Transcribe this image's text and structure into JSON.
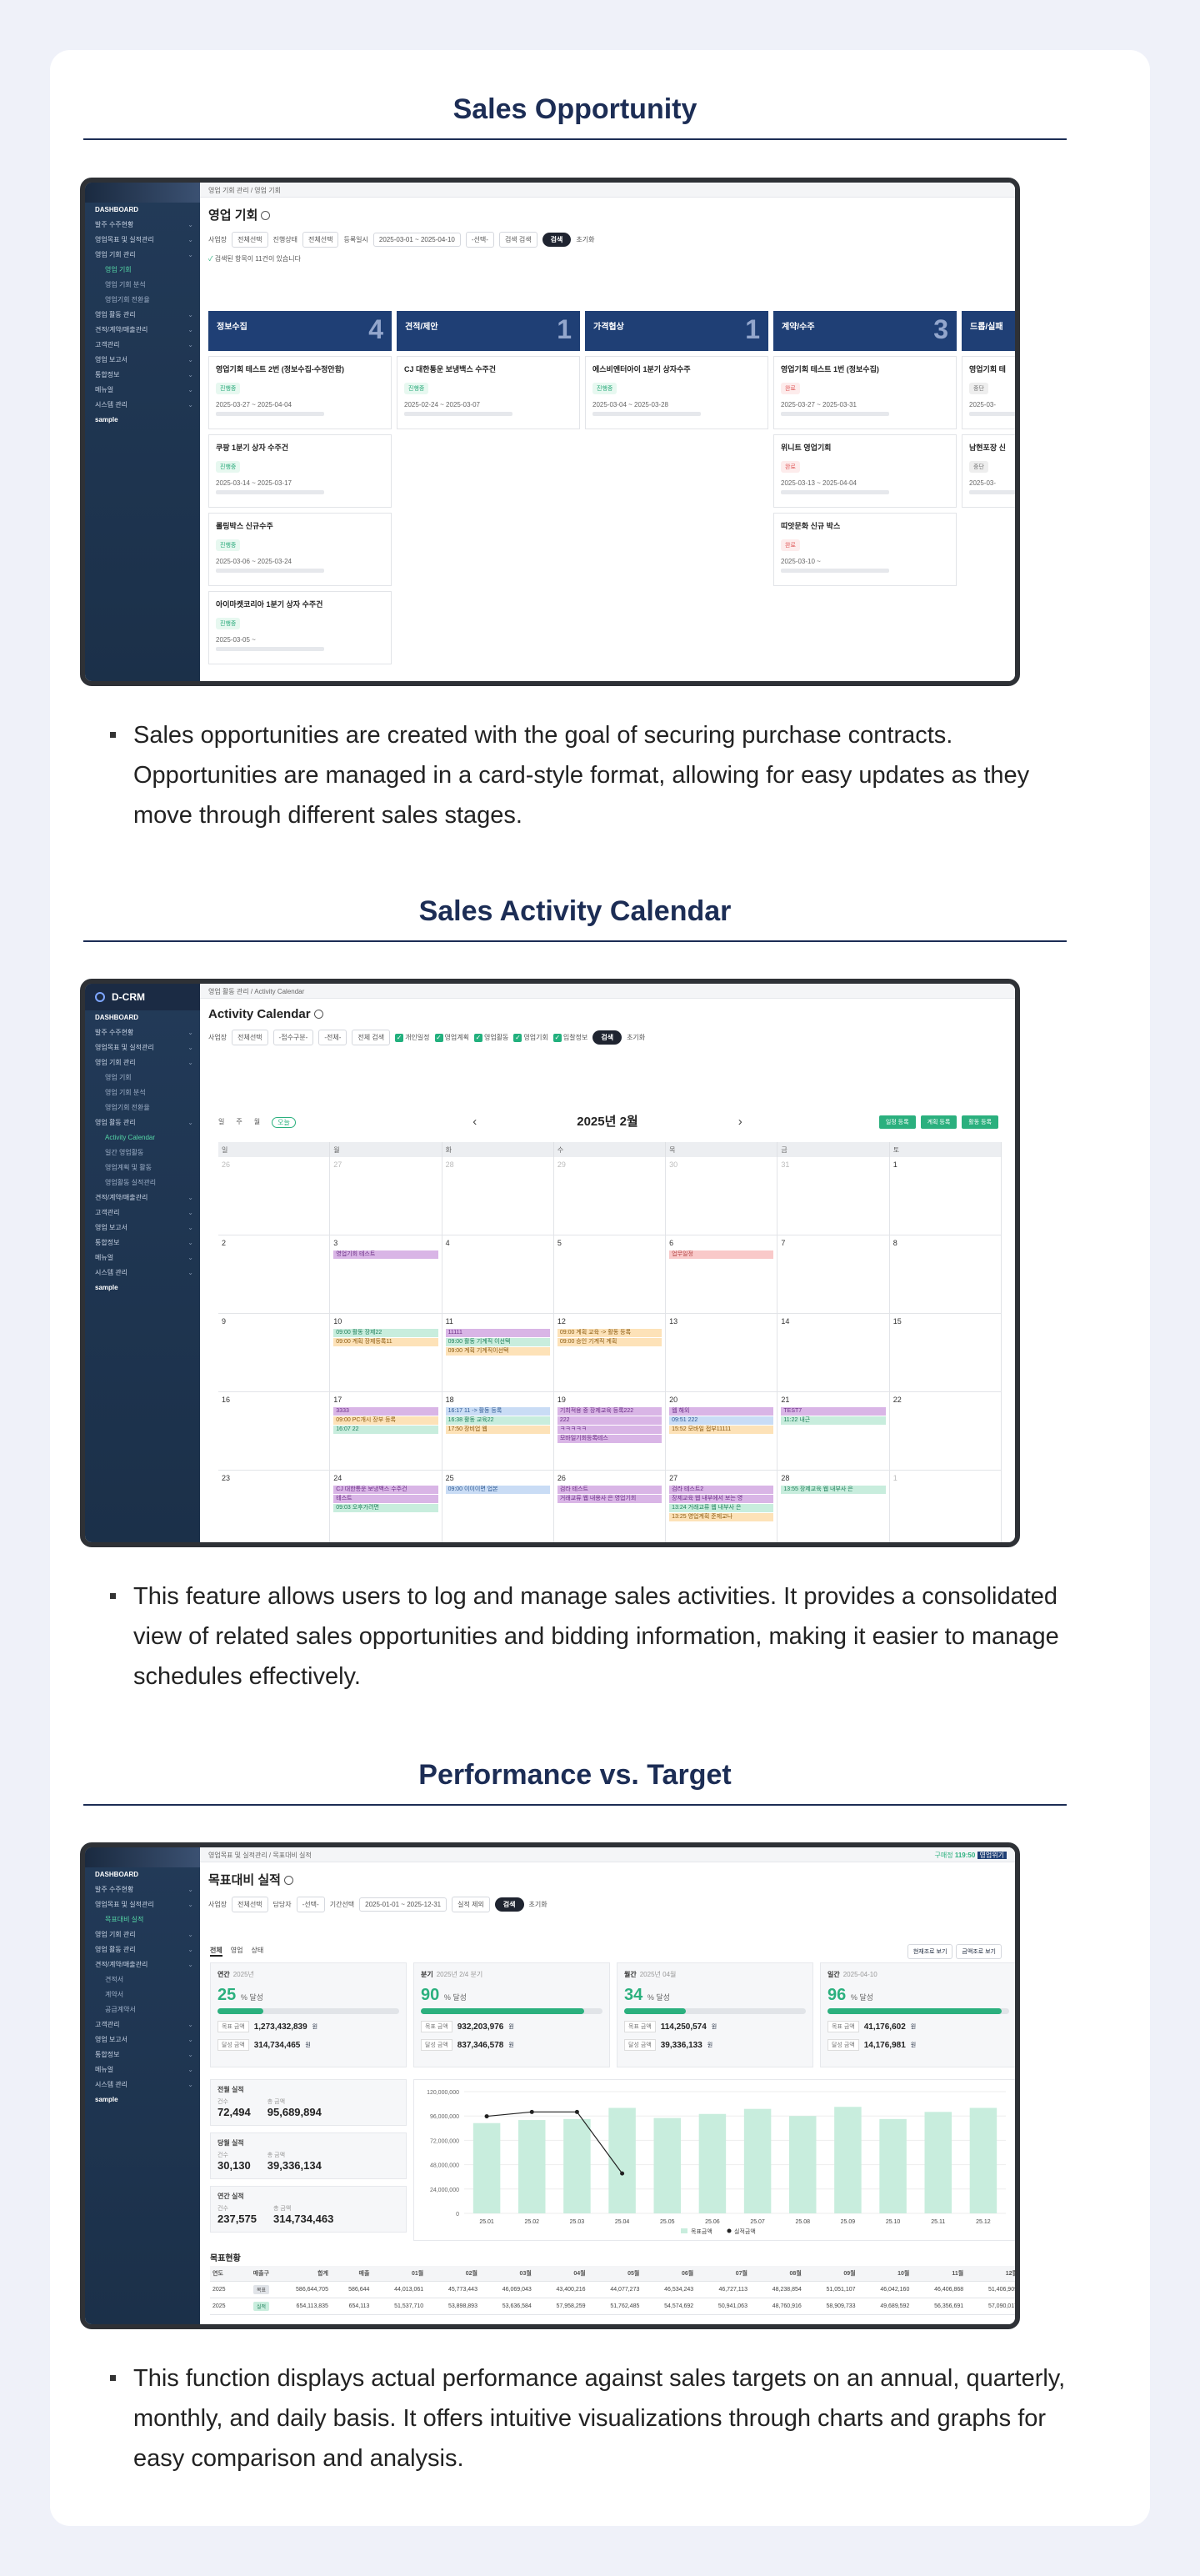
{
  "sections": [
    {
      "title": "Sales Opportunity",
      "description": "Sales opportunities are created with the goal of securing purchase contracts. Opportunities are managed in a card-style format, allowing for easy updates as they move through different sales stages."
    },
    {
      "title": "Sales Activity Calendar",
      "description": "This feature allows users to log and manage sales activities. It provides a consolidated view of related sales opportunities and bidding information, making it easier to manage schedules effectively."
    },
    {
      "title": "Performance vs. Target",
      "description": "This function displays actual performance against sales targets on an annual, quarterly, monthly, and daily basis. It offers intuitive visualizations through charts and graphs for easy comparison and analysis."
    }
  ],
  "app": {
    "brand": "D-CRM",
    "sidebar": [
      {
        "label": "DASHBOARD",
        "level": "head"
      },
      {
        "label": "발주 수주현황",
        "level": "top"
      },
      {
        "label": "영업목표 및 실적관리",
        "level": "top"
      },
      {
        "label": "영업 기회 관리",
        "level": "top"
      },
      {
        "label": "영업 기회",
        "level": "sub",
        "active": true
      },
      {
        "label": "영업 기회 분석",
        "level": "sub"
      },
      {
        "label": "영업기회 전환율",
        "level": "sub"
      },
      {
        "label": "영업 활동 관리",
        "level": "top"
      },
      {
        "label": "견적/계약/매출관리",
        "level": "top"
      },
      {
        "label": "고객관리",
        "level": "top"
      },
      {
        "label": "영업 보고서",
        "level": "top"
      },
      {
        "label": "통합정보",
        "level": "top"
      },
      {
        "label": "메뉴얼",
        "level": "top"
      },
      {
        "label": "시스템 관리",
        "level": "top"
      },
      {
        "label": "sample",
        "level": "head"
      }
    ],
    "sidebar2": [
      {
        "label": "DASHBOARD",
        "level": "head"
      },
      {
        "label": "발주 수주현황",
        "level": "top"
      },
      {
        "label": "영업목표 및 실적관리",
        "level": "top"
      },
      {
        "label": "영업 기회 관리",
        "level": "top"
      },
      {
        "label": "영업 기회",
        "level": "sub"
      },
      {
        "label": "영업 기회 분석",
        "level": "sub"
      },
      {
        "label": "영업기회 전환율",
        "level": "sub"
      },
      {
        "label": "영업 활동 관리",
        "level": "top"
      },
      {
        "label": "Activity Calendar",
        "level": "sub",
        "active": true
      },
      {
        "label": "일간 영업활동",
        "level": "sub"
      },
      {
        "label": "영업계획 및 활동",
        "level": "sub"
      },
      {
        "label": "영업활동 실적관리",
        "level": "sub"
      },
      {
        "label": "견적/계약/매출관리",
        "level": "top"
      },
      {
        "label": "고객관리",
        "level": "top"
      },
      {
        "label": "영업 보고서",
        "level": "top"
      },
      {
        "label": "통합정보",
        "level": "top"
      },
      {
        "label": "메뉴얼",
        "level": "top"
      },
      {
        "label": "시스템 관리",
        "level": "top"
      },
      {
        "label": "sample",
        "level": "head"
      }
    ],
    "sidebar3": [
      {
        "label": "DASHBOARD",
        "level": "head"
      },
      {
        "label": "발주 수주현황",
        "level": "top"
      },
      {
        "label": "영업목표 및 실적관리",
        "level": "top"
      },
      {
        "label": "목표대비 실적",
        "level": "sub",
        "active": true
      },
      {
        "label": "영업 기회 관리",
        "level": "top"
      },
      {
        "label": "영업 활동 관리",
        "level": "top"
      },
      {
        "label": "견적/계약/매출관리",
        "level": "top"
      },
      {
        "label": "견적서",
        "level": "sub"
      },
      {
        "label": "계약서",
        "level": "sub"
      },
      {
        "label": "공급계약서",
        "level": "sub"
      },
      {
        "label": "고객관리",
        "level": "top"
      },
      {
        "label": "영업 보고서",
        "level": "top"
      },
      {
        "label": "통합정보",
        "level": "top"
      },
      {
        "label": "메뉴얼",
        "level": "top"
      },
      {
        "label": "시스템 관리",
        "level": "top"
      },
      {
        "label": "sample",
        "level": "head"
      }
    ]
  },
  "opportunity": {
    "breadcrumb": "영업 기회 관리 / 영업 기회",
    "title": "영업 기회",
    "filters": [
      "사업장",
      "전체선택",
      "진행상태",
      "전체선택",
      "등록일시",
      "2025-03-01 ~ 2025-04-10",
      "-선택-",
      "검색 검색"
    ],
    "search_label": "검색",
    "reset_label": "초기화",
    "result_text": "검색된 항목이 11건이 있습니다",
    "columns": [
      {
        "name": "정보수집",
        "count": "4",
        "cards": [
          {
            "title": "영업기회 테스트 2번 (정보수집-수정안함)",
            "tag": "진행중",
            "tagc": "",
            "date": "2025-03-27 ~ 2025-04-04"
          },
          {
            "title": "쿠팡 1분기 상자 수주건",
            "tag": "진행중",
            "tagc": "",
            "date": "2025-03-14 ~ 2025-03-17"
          },
          {
            "title": "롤링박스 신규수주",
            "tag": "진행중",
            "tagc": "",
            "date": "2025-03-06 ~ 2025-03-24"
          },
          {
            "title": "아이마켓코리아 1분기 상자 수주건",
            "tag": "진행중",
            "tagc": "",
            "date": "2025-03-05 ~"
          }
        ]
      },
      {
        "name": "견적/제안",
        "count": "1",
        "cards": [
          {
            "title": "CJ 대한통운 보냉백스 수주건",
            "tag": "진행중",
            "tagc": "",
            "date": "2025-02-24 ~ 2025-03-07"
          }
        ]
      },
      {
        "name": "가격협상",
        "count": "1",
        "cards": [
          {
            "title": "에스비엔터아이 1분기 상자수주",
            "tag": "진행중",
            "tagc": "",
            "date": "2025-03-04 ~ 2025-03-28"
          }
        ]
      },
      {
        "name": "계약/수주",
        "count": "3",
        "cards": [
          {
            "title": "영업기회 테스트 1번 (정보수집)",
            "tag": "완료",
            "tagc": "red",
            "date": "2025-03-27 ~ 2025-03-31"
          },
          {
            "title": "위니트 영업기회",
            "tag": "완료",
            "tagc": "red",
            "date": "2025-03-13 ~ 2025-04-04"
          },
          {
            "title": "띠앗문화 신규 박스",
            "tag": "완료",
            "tagc": "red",
            "date": "2025-03-10 ~"
          }
        ]
      },
      {
        "name": "드롭/실패",
        "count": "",
        "cards": [
          {
            "title": "영업기회 테",
            "tag": "중단",
            "tagc": "gray",
            "date": "2025-03-"
          },
          {
            "title": "남현포장 신",
            "tag": "중단",
            "tagc": "gray",
            "date": "2025-03-"
          }
        ]
      }
    ]
  },
  "calendar": {
    "breadcrumb": "영업 활동 관리 / Activity Calendar",
    "title": "Activity Calendar",
    "filters": [
      "사업장",
      "전체선택",
      "-접수구분-",
      "-전체-",
      "전체 검색"
    ],
    "checks": [
      "개인일정",
      "영업계획",
      "영업활동",
      "영업기회",
      "입찰정보"
    ],
    "search_label": "검색",
    "reset_label": "초기화",
    "view_tabs": [
      "일",
      "주",
      "월",
      "오늘"
    ],
    "month": "2025년 2월",
    "buttons": [
      "일정 등록",
      "계획 등록",
      "활동 등록"
    ],
    "weekdays": [
      "일",
      "월",
      "화",
      "수",
      "목",
      "금",
      "토"
    ],
    "weeks": [
      [
        {
          "n": "26",
          "dim": true
        },
        {
          "n": "27",
          "dim": true
        },
        {
          "n": "28",
          "dim": true
        },
        {
          "n": "29",
          "dim": true
        },
        {
          "n": "30",
          "dim": true
        },
        {
          "n": "31",
          "dim": true
        },
        {
          "n": "1"
        }
      ],
      [
        {
          "n": "2"
        },
        {
          "n": "3",
          "ev": [
            [
              "p",
              "영업기회 테스트"
            ]
          ]
        },
        {
          "n": "4"
        },
        {
          "n": "5"
        },
        {
          "n": "6",
          "ev": [
            [
              "r",
              "업무일정"
            ]
          ]
        },
        {
          "n": "7"
        },
        {
          "n": "8"
        }
      ],
      [
        {
          "n": "9"
        },
        {
          "n": "10",
          "ev": [
            [
              "g",
              "09:00 활동 장제22"
            ],
            [
              "o",
              "09:00 계획 장제등록11"
            ]
          ]
        },
        {
          "n": "11",
          "ev": [
            [
              "p",
              "11111"
            ],
            [
              "g",
              "09:00 활동 기계직 이선택"
            ],
            [
              "o",
              "09:00 계획 기계직이선택"
            ]
          ]
        },
        {
          "n": "12",
          "ev": [
            [
              "o",
              "09:00 계획 교육 -> 활동 등록"
            ],
            [
              "o",
              "09:00 승인 기계직 계획"
            ]
          ]
        },
        {
          "n": "13"
        },
        {
          "n": "14"
        },
        {
          "n": "15"
        }
      ],
      [
        {
          "n": "16"
        },
        {
          "n": "17",
          "ev": [
            [
              "p",
              "3333"
            ],
            [
              "o",
              "09:00 PC개시 장부 등록"
            ],
            [
              "g",
              "16:07 22"
            ]
          ]
        },
        {
          "n": "18",
          "ev": [
            [
              "b",
              "16:17 11 -> 활동 등록"
            ],
            [
              "g",
              "16:38 활동 교육22"
            ],
            [
              "o",
              "17:50 장비업 웹"
            ]
          ]
        },
        {
          "n": "19",
          "ev": [
            [
              "p",
              "기최적용 중 장제교육 등록222"
            ],
            [
              "p",
              "222"
            ],
            [
              "p",
              "ㅋㅋㅋㅋㅋ"
            ],
            [
              "p",
              "모바일기회등록테스"
            ]
          ]
        },
        {
          "n": "20",
          "ev": [
            [
              "p",
              "웹 해외"
            ],
            [
              "b",
              "09:51 222"
            ],
            [
              "o",
              "15:52 모바일 접부11111"
            ]
          ]
        },
        {
          "n": "21",
          "ev": [
            [
              "p",
              "TEST7"
            ],
            [
              "g",
              "11:22 내근"
            ]
          ]
        },
        {
          "n": "22"
        }
      ],
      [
        {
          "n": "23"
        },
        {
          "n": "24",
          "ev": [
            [
              "p",
              "CJ 대한통운 보냉백스 수주건"
            ],
            [
              "p",
              "테스트"
            ],
            [
              "g",
              "09:03 오후가려면"
            ]
          ]
        },
        {
          "n": "25",
          "ev": [
            [
              "b",
              "09:00 이이이면 업본"
            ]
          ]
        },
        {
          "n": "26",
          "ev": [
            [
              "p",
              "검라 테스트"
            ],
            [
              "p",
              "거래교류 웹 내용사 은 영업기회"
            ]
          ]
        },
        {
          "n": "27",
          "ev": [
            [
              "p",
              "검라 테스트2"
            ],
            [
              "p",
              "장제교육 웹 내부에서 보는 영"
            ],
            [
              "g",
              "13:24 거래교류 웹 내부사 은"
            ],
            [
              "o",
              "13:25 영업계획 준제교나"
            ]
          ]
        },
        {
          "n": "28",
          "ev": [
            [
              "g",
              "13:55 장제교육 웹 내부사 은"
            ]
          ]
        },
        {
          "n": "1",
          "dim": true
        }
      ]
    ]
  },
  "performance": {
    "breadcrumb": "영업목표 및 실적관리 / 목표대비 실적",
    "title": "목표대비 실적",
    "top_right": [
      "구매정",
      "119:50",
      "영업위기"
    ],
    "filters": [
      "사업장",
      "전체선택",
      "담당자",
      "-선택-",
      "기간선택",
      "2025-01-01 ~ 2025-12-31",
      "실적 제외"
    ],
    "search_label": "검색",
    "reset_label": "초기화",
    "tabs": [
      "전체",
      "영업",
      "상태"
    ],
    "view_buttons": [
      "현재조로 보기",
      "금액조로 보기"
    ],
    "kpis": [
      {
        "label": "연간",
        "sub": "2025년",
        "pct": "25",
        "fill": 0.25,
        "target": "1,273,432,839",
        "actual": "314,734,465"
      },
      {
        "label": "분기",
        "sub": "2025년 2/4 분기",
        "pct": "90",
        "fill": 0.9,
        "target": "932,203,976",
        "actual": "837,346,578"
      },
      {
        "label": "월간",
        "sub": "2025년 04월",
        "pct": "34",
        "fill": 0.34,
        "target": "114,250,574",
        "actual": "39,336,133"
      },
      {
        "label": "일간",
        "sub": "2025-04-10",
        "pct": "96",
        "fill": 0.96,
        "target": "41,176,602",
        "actual": "14,176,981"
      }
    ],
    "pct_unit": "% 달성",
    "target_label": "목표 금액",
    "actual_label": "달성 금액",
    "won": "원",
    "minis": [
      {
        "title": "전월 실적",
        "count_label": "건수",
        "count": "72,494",
        "amount_label": "총 금액",
        "amount": "95,689,894"
      },
      {
        "title": "당월 실적",
        "count_label": "건수",
        "count": "30,130",
        "amount_label": "총 금액",
        "amount": "39,336,134"
      },
      {
        "title": "연간 실적",
        "count_label": "건수",
        "count": "237,575",
        "amount_label": "총 금액",
        "amount": "314,734,463"
      }
    ],
    "table_title": "목표현황",
    "table_headers": [
      "연도",
      "매출구",
      "합계",
      "매출",
      "01월",
      "02월",
      "03월",
      "04월",
      "05월",
      "06월",
      "07월",
      "08월",
      "09월",
      "10월",
      "11월",
      "12월"
    ],
    "table_rows": [
      [
        "2025",
        "목표",
        "586,644,705",
        "586,644",
        "44,013,061",
        "45,773,443",
        "46,069,043",
        "43,400,216",
        "44,077,273",
        "46,534,243",
        "46,727,113",
        "48,238,854",
        "51,051,107",
        "46,042,160",
        "46,406,868",
        "51,406,909"
      ],
      [
        "2025",
        "실적",
        "654,113,835",
        "654,113",
        "51,537,710",
        "53,898,893",
        "53,636,584",
        "57,958,259",
        "51,762,485",
        "54,574,692",
        "50,941,063",
        "48,760,916",
        "58,909,733",
        "49,689,592",
        "56,356,691",
        "57,090,017"
      ]
    ]
  },
  "chart_data": {
    "type": "bar",
    "categories": [
      "25.01",
      "25.02",
      "25.03",
      "25.04",
      "25.05",
      "25.06",
      "25.07",
      "25.08",
      "25.09",
      "25.10",
      "25.11",
      "25.12"
    ],
    "series": [
      {
        "name": "목표금액",
        "type": "bar",
        "color": "#c8eddd",
        "values": [
          89000000,
          92000000,
          93000000,
          104000000,
          94000000,
          98000000,
          103000000,
          96000000,
          105000000,
          93000000,
          100000000,
          104000000
        ]
      },
      {
        "name": "실적금액",
        "type": "line",
        "color": "#222222",
        "values": [
          95689894,
          100000000,
          100000000,
          39336134
        ]
      }
    ],
    "y_ticks": [
      "0",
      "24,000,000",
      "48,000,000",
      "72,000,000",
      "96,000,000",
      "120,000,000"
    ],
    "ylim": [
      0,
      120000000
    ],
    "legend": "bottom-center"
  }
}
